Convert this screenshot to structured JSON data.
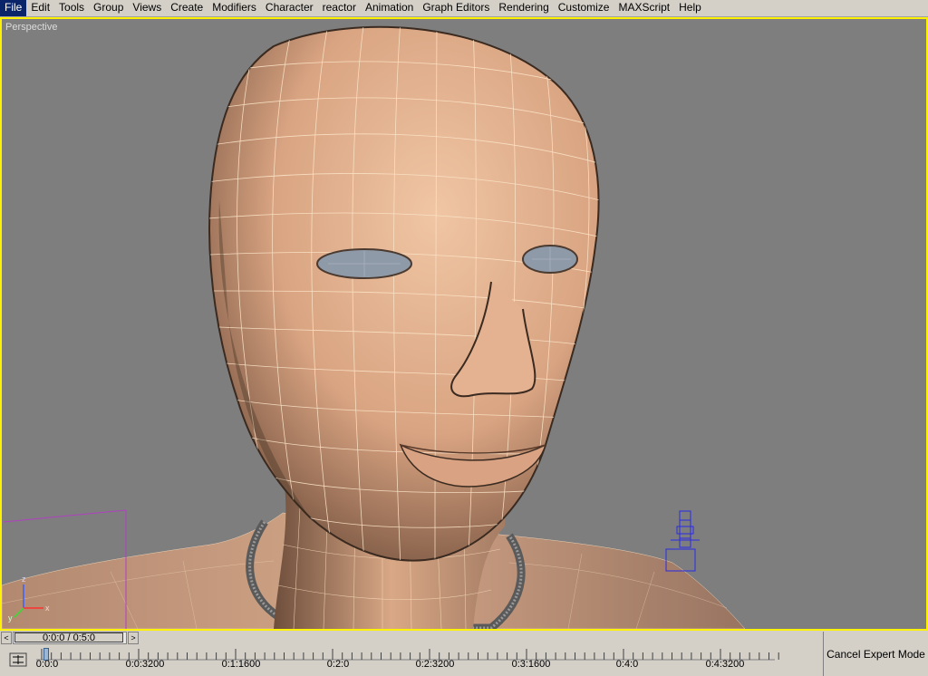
{
  "menu": [
    "File",
    "Edit",
    "Tools",
    "Group",
    "Views",
    "Create",
    "Modifiers",
    "Character",
    "reactor",
    "Animation",
    "Graph Editors",
    "Rendering",
    "Customize",
    "MAXScript",
    "Help"
  ],
  "viewport": {
    "label": "Perspective",
    "axis_labels": {
      "x": "x",
      "y": "y",
      "z": "z"
    }
  },
  "time_slider": {
    "value": "0:0:0 / 0:5:0",
    "prev_arrow": "<",
    "next_arrow": ">"
  },
  "trackbar": {
    "ticks": [
      "0:0:0",
      "0:0:3200",
      "0:1:1600",
      "0:2:0",
      "0:2:3200",
      "0:3:1600",
      "0:4:0",
      "0:4:3200"
    ]
  },
  "cancel_expert_label": "Cancel Expert Mode",
  "colors": {
    "viewport_bg": "#7e7e7e",
    "active_border": "#fff200",
    "skin": "#e2b08f",
    "wire": "#fbe4c8",
    "eyes": "#8f9aa8",
    "helper": "#2a2ae6",
    "bbox": "#b040c0"
  }
}
